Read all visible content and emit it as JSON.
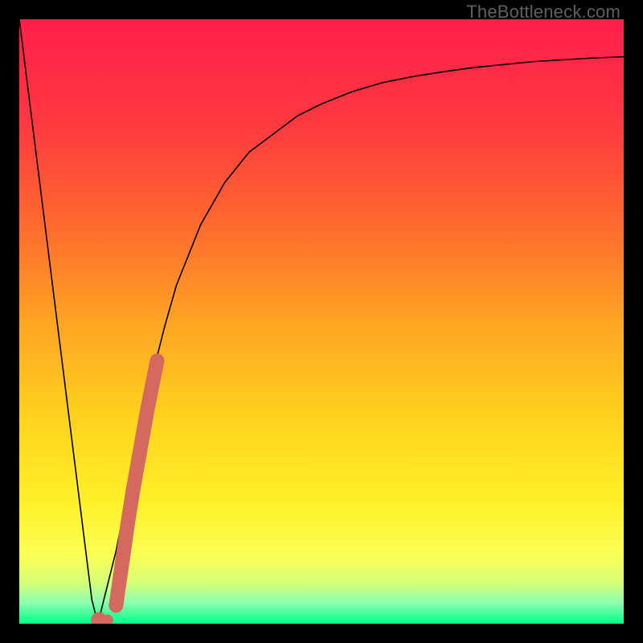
{
  "watermark": "TheBottleneck.com",
  "chart_data": {
    "type": "line",
    "title": "",
    "xlabel": "",
    "ylabel": "",
    "xlim": [
      0,
      100
    ],
    "ylim": [
      0,
      100
    ],
    "grid": false,
    "series": [
      {
        "name": "curve",
        "color": "#000000",
        "x": [
          0,
          2,
          4,
          6,
          8,
          9,
          10,
          11,
          12,
          13,
          14,
          16,
          18,
          20,
          22,
          24,
          26,
          28,
          30,
          34,
          38,
          42,
          46,
          50,
          55,
          60,
          65,
          70,
          75,
          80,
          85,
          90,
          95,
          100
        ],
        "y": [
          100,
          84,
          68,
          52,
          36,
          28,
          20,
          12,
          4,
          0,
          4,
          12,
          22,
          32,
          41,
          49,
          56,
          61,
          66,
          73,
          78,
          81,
          84,
          86,
          88,
          89.5,
          90.5,
          91.3,
          92,
          92.5,
          93,
          93.3,
          93.6,
          93.8
        ]
      },
      {
        "name": "marker-band",
        "color": "#d46a5f",
        "x": [
          13.2,
          14.6,
          16.0,
          17.0,
          18.0,
          18.8,
          19.6,
          20.4,
          21.2,
          22.0,
          22.8
        ],
        "y": [
          0.6,
          0.6,
          3.0,
          10,
          17,
          22,
          26.5,
          31,
          35.5,
          39.5,
          43.5
        ]
      }
    ],
    "gradient_stops": [
      {
        "offset": 0.0,
        "color": "#ff1f4b"
      },
      {
        "offset": 0.18,
        "color": "#ff3a3f"
      },
      {
        "offset": 0.34,
        "color": "#ff6a2e"
      },
      {
        "offset": 0.5,
        "color": "#ffa423"
      },
      {
        "offset": 0.66,
        "color": "#ffd21e"
      },
      {
        "offset": 0.8,
        "color": "#fff029"
      },
      {
        "offset": 0.885,
        "color": "#fbff55"
      },
      {
        "offset": 0.93,
        "color": "#d8ff74"
      },
      {
        "offset": 0.965,
        "color": "#8dffb0"
      },
      {
        "offset": 1.0,
        "color": "#00ff87"
      }
    ]
  }
}
